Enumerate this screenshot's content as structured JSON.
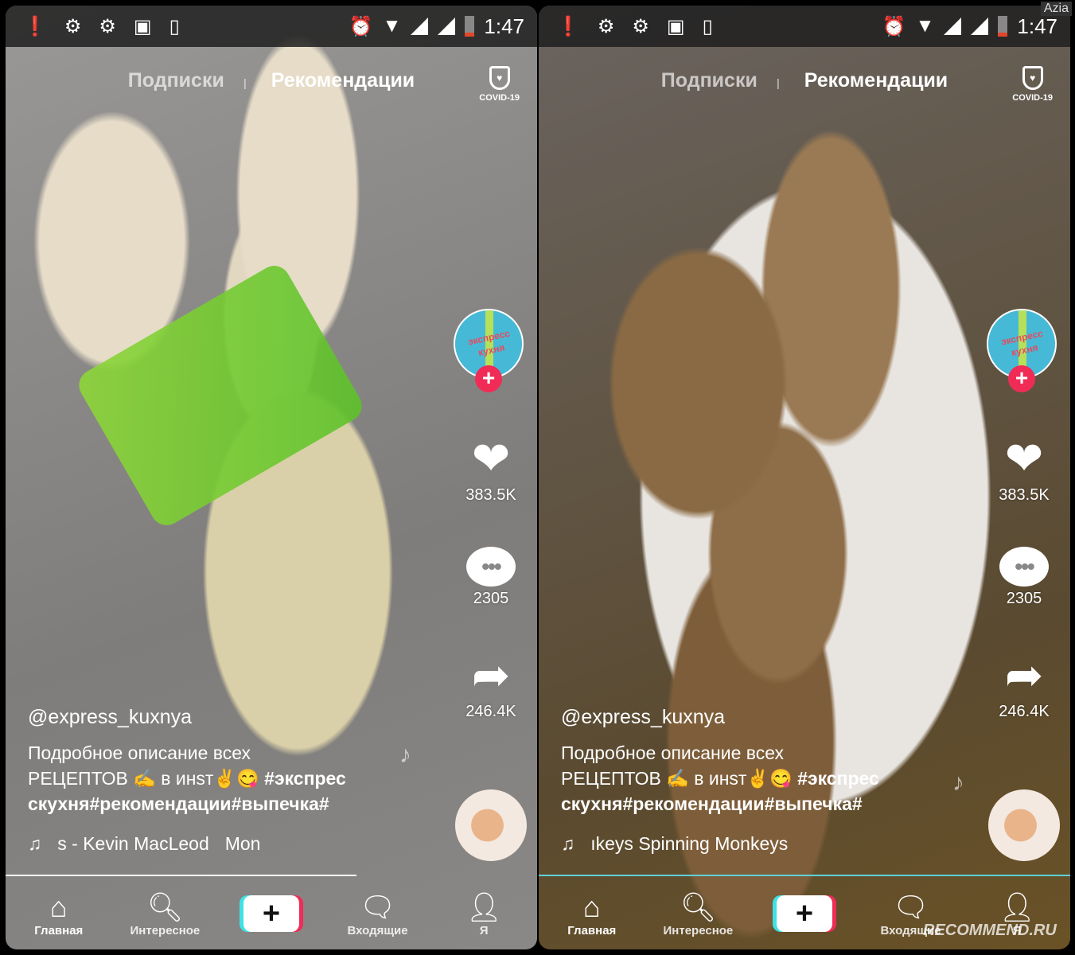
{
  "panels": [
    {
      "status": {
        "time": "1:47"
      },
      "tabs": {
        "following": "Подписки",
        "for_you": "Рекомендации"
      },
      "covid_label": "COVID-19",
      "avatar_text": "экспресс кухня",
      "likes": "383.5K",
      "comments": "2305",
      "shares": "246.4K",
      "username": "@express_kuxnya",
      "description": {
        "line1": "Подробное описание всех",
        "line2_plain": "РЕЦЕПТОВ ✍️ в инsт✌️😋 ",
        "line2_tag": "#экспрес",
        "line3": "скухня#рекомендации#выпечка#"
      },
      "music": {
        "part1": "s - Kevin MacLeod",
        "part2": "Mon"
      },
      "progress_percent": 66
    },
    {
      "status": {
        "time": "1:47"
      },
      "tabs": {
        "following": "Подписки",
        "for_you": "Рекомендации"
      },
      "covid_label": "COVID-19",
      "avatar_text": "экспресс кухня",
      "likes": "383.5K",
      "comments": "2305",
      "shares": "246.4K",
      "username": "@express_kuxnya",
      "description": {
        "line1": "Подробное описание всех",
        "line2_plain": "РЕЦЕПТОВ ✍️ в инsт✌️😋 ",
        "line2_tag": "#экспрес",
        "line3": "скухня#рекомендации#выпечка#"
      },
      "music": {
        "part1": "ıkeys Spinning Monkeys",
        "part2": ""
      },
      "progress_percent": 100
    }
  ],
  "nav": {
    "home": "Главная",
    "discover": "Интересное",
    "create": "+",
    "inbox": "Входящие",
    "me": "Я"
  },
  "colors": {
    "accent_red": "#f02c56",
    "accent_cyan": "#3ee2e6",
    "progress_bar_left": "#ffffff",
    "progress_bar_right": "#5fd0d8"
  },
  "watermarks": {
    "top": "Azia",
    "bottom": "RECOMMEND.RU"
  }
}
